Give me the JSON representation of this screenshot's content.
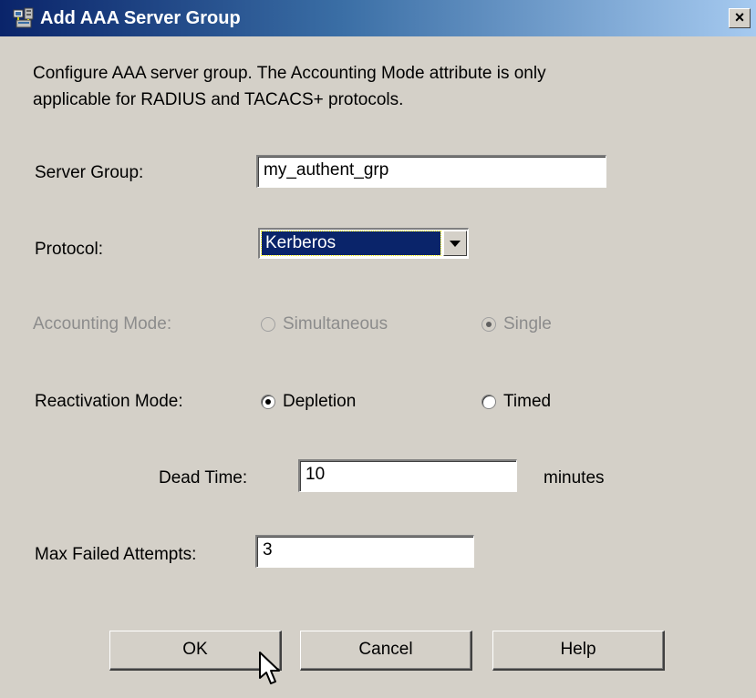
{
  "window": {
    "title": "Add AAA Server Group",
    "close_glyph": "×"
  },
  "description": {
    "line1": "Configure AAA server group.  The Accounting Mode attribute is only",
    "line2": "applicable for RADIUS and TACACS+ protocols."
  },
  "server_group": {
    "label": "Server Group:",
    "value": "my_authent_grp"
  },
  "protocol": {
    "label": "Protocol:",
    "selected": "Kerberos"
  },
  "accounting_mode": {
    "label": "Accounting Mode:",
    "options": [
      "Simultaneous",
      "Single"
    ],
    "selected": "Single",
    "enabled": false
  },
  "reactivation_mode": {
    "label": "Reactivation Mode:",
    "options": [
      "Depletion",
      "Timed"
    ],
    "selected": "Depletion"
  },
  "dead_time": {
    "label": "Dead Time:",
    "value": "10",
    "unit": "minutes"
  },
  "max_failed_attempts": {
    "label": "Max Failed Attempts:",
    "value": "3"
  },
  "buttons": {
    "ok": "OK",
    "cancel": "Cancel",
    "help": "Help"
  },
  "colors": {
    "titlebar_start": "#0a246a",
    "titlebar_end": "#a6caf0",
    "dialog_bg": "#d4d0c8",
    "disabled_text": "#8c8c8c",
    "selection_bg": "#0a246a"
  },
  "icons": {
    "title": "network-servers-icon",
    "close": "close-icon",
    "pointer": "mouse-pointer-icon"
  }
}
